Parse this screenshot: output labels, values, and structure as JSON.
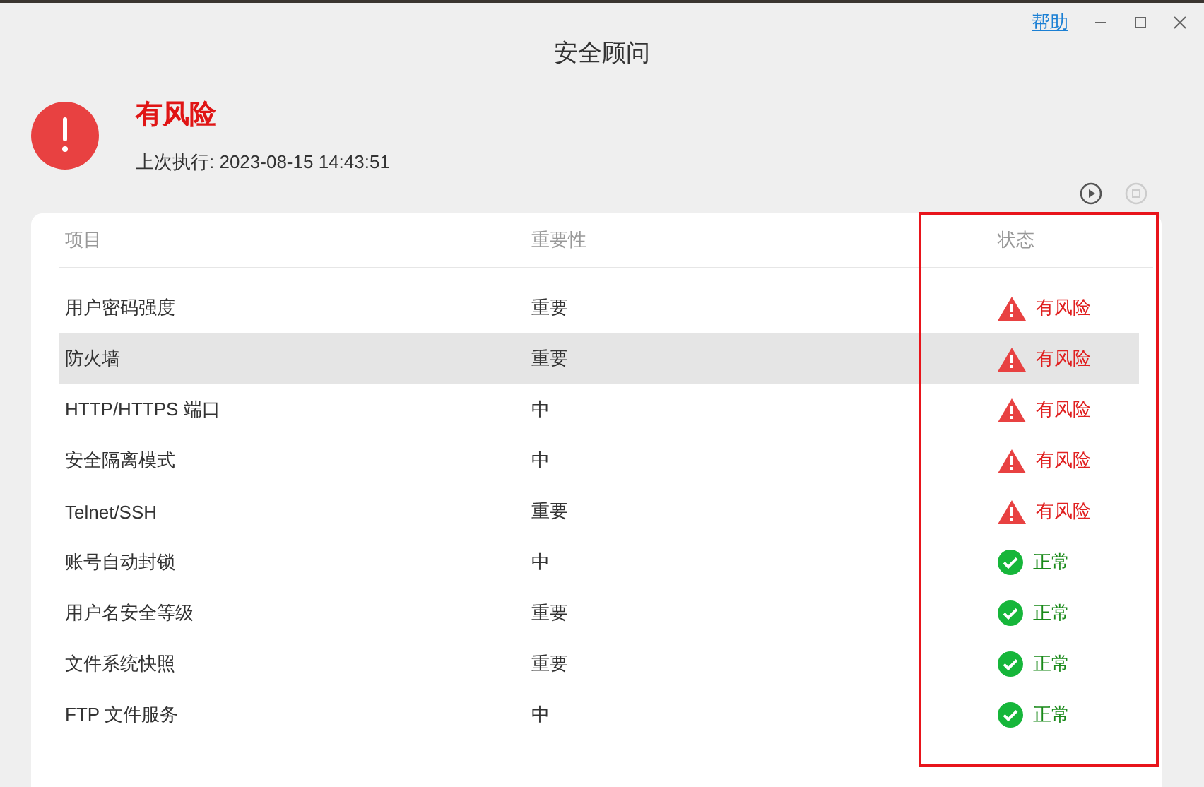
{
  "window": {
    "title": "安全顾问",
    "help_link": "帮助"
  },
  "summary": {
    "status": "有风险",
    "last_run": "上次执行: 2023-08-15 14:43:51"
  },
  "table": {
    "columns": [
      "项目",
      "重要性",
      "状态"
    ],
    "rows": [
      {
        "item": "用户密码强度",
        "importance": "重要",
        "status": "有风险",
        "kind": "risk",
        "selected": false
      },
      {
        "item": "防火墙",
        "importance": "重要",
        "status": "有风险",
        "kind": "risk",
        "selected": true
      },
      {
        "item": "HTTP/HTTPS 端口",
        "importance": "中",
        "status": "有风险",
        "kind": "risk",
        "selected": false
      },
      {
        "item": "安全隔离模式",
        "importance": "中",
        "status": "有风险",
        "kind": "risk",
        "selected": false
      },
      {
        "item": "Telnet/SSH",
        "importance": "重要",
        "status": "有风险",
        "kind": "risk",
        "selected": false
      },
      {
        "item": "账号自动封锁",
        "importance": "中",
        "status": "正常",
        "kind": "ok",
        "selected": false
      },
      {
        "item": "用户名安全等级",
        "importance": "重要",
        "status": "正常",
        "kind": "ok",
        "selected": false
      },
      {
        "item": "文件系统快照",
        "importance": "重要",
        "status": "正常",
        "kind": "ok",
        "selected": false
      },
      {
        "item": "FTP 文件服务",
        "importance": "中",
        "status": "正常",
        "kind": "ok",
        "selected": false
      }
    ]
  }
}
